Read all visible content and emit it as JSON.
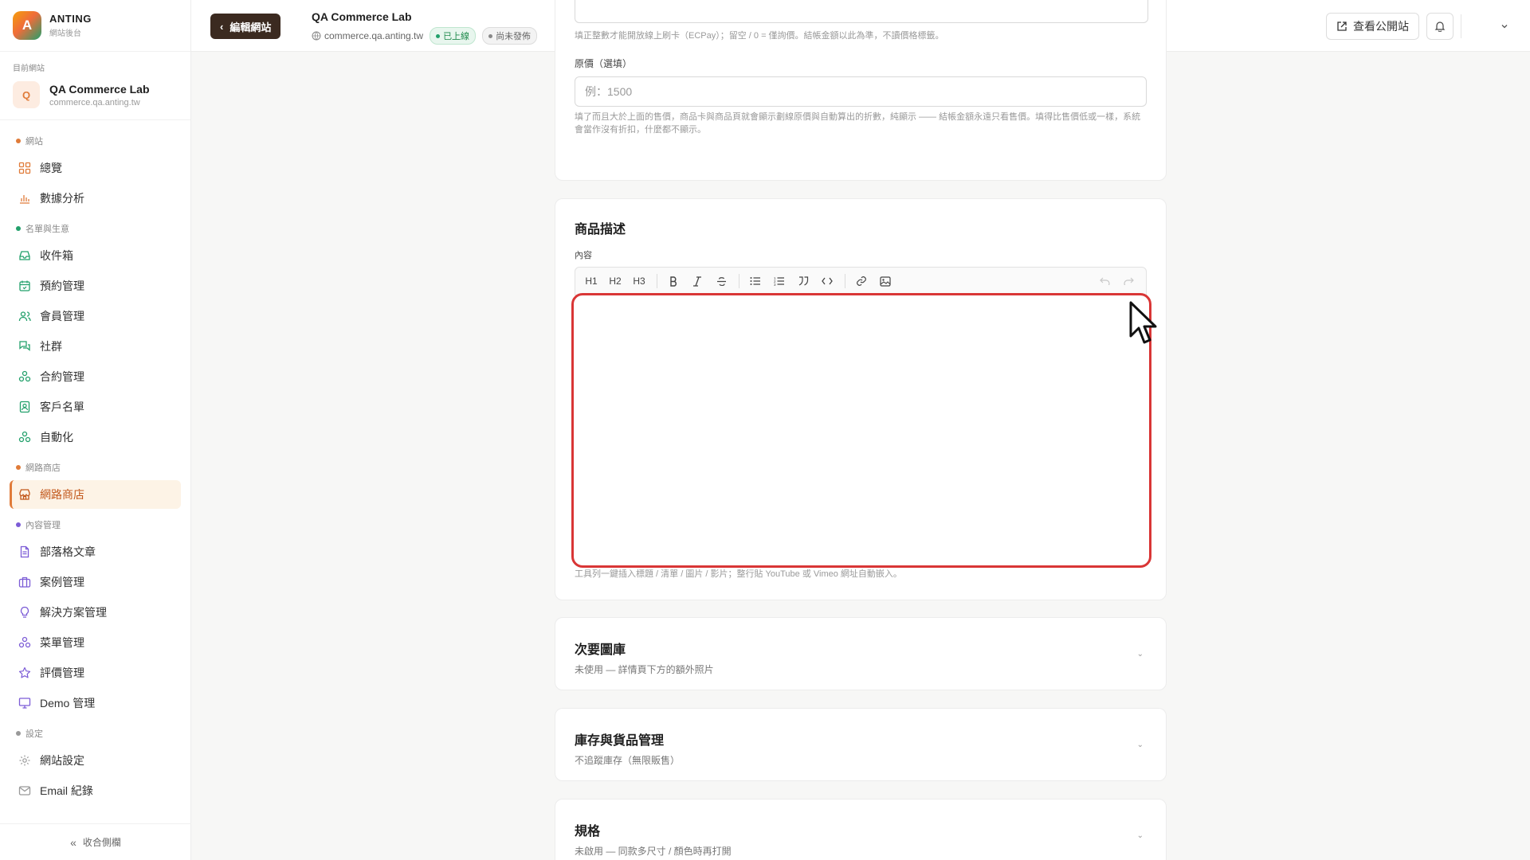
{
  "brand": {
    "name": "ANTING",
    "sub": "網站後台",
    "logo_letter": "A"
  },
  "current_site": {
    "label": "目前網站",
    "avatar": "Q",
    "name": "QA Commerce Lab",
    "domain": "commerce.qa.anting.tw"
  },
  "sidebar": {
    "sections": [
      {
        "title": "網站",
        "color": "#e07b39",
        "items": [
          {
            "label": "總覽",
            "icon": "grid-icon"
          },
          {
            "label": "數據分析",
            "icon": "bar-chart-icon"
          }
        ]
      },
      {
        "title": "名單與生意",
        "color": "#22a06b",
        "items": [
          {
            "label": "收件箱",
            "icon": "inbox-icon"
          },
          {
            "label": "預約管理",
            "icon": "calendar-icon"
          },
          {
            "label": "會員管理",
            "icon": "users-icon"
          },
          {
            "label": "社群",
            "icon": "chat-icon"
          },
          {
            "label": "合約管理",
            "icon": "cluster-icon"
          },
          {
            "label": "客戶名單",
            "icon": "contact-icon"
          },
          {
            "label": "自動化",
            "icon": "automation-icon"
          }
        ]
      },
      {
        "title": "網路商店",
        "color": "#e07b39",
        "items": [
          {
            "label": "網路商店",
            "icon": "store-icon",
            "active": true
          }
        ]
      },
      {
        "title": "內容管理",
        "color": "#7c5cd6",
        "items": [
          {
            "label": "部落格文章",
            "icon": "document-icon"
          },
          {
            "label": "案例管理",
            "icon": "briefcase-icon"
          },
          {
            "label": "解決方案管理",
            "icon": "lightbulb-icon"
          },
          {
            "label": "菜單管理",
            "icon": "menu-cluster-icon"
          },
          {
            "label": "評價管理",
            "icon": "star-icon"
          },
          {
            "label": "Demo 管理",
            "icon": "monitor-icon"
          }
        ]
      },
      {
        "title": "設定",
        "color": "#999999",
        "items": [
          {
            "label": "網站設定",
            "icon": "gear-icon"
          },
          {
            "label": "Email 紀錄",
            "icon": "mail-icon"
          }
        ]
      }
    ],
    "collapse_label": "收合側欄"
  },
  "topbar": {
    "back_label": "編輯網站",
    "title": "QA Commerce Lab",
    "domain": "commerce.qa.anting.tw",
    "badge_live": "已上線",
    "badge_draft": "尚未發佈",
    "view_site": "查看公開站"
  },
  "pricing": {
    "price_hint": "填正整數才能開放線上刷卡（ECPay）；留空 / 0 = 僅詢價。結帳金額以此為準，不讀價格標籤。",
    "original_label": "原價（選填）",
    "original_placeholder": "例：1500",
    "original_hint": "填了而且大於上面的售價，商品卡與商品頁就會顯示劃線原價與自動算出的折數，純顯示 —— 結帳金額永遠只看售價。填得比售價低或一樣，系統會當作沒有折扣，什麼都不顯示。"
  },
  "description": {
    "title": "商品描述",
    "content_label": "內容",
    "toolbar": [
      "H1",
      "H2",
      "H3"
    ],
    "hint": "工具列一鍵插入標題 / 清單 / 圖片 / 影片；整行貼 YouTube 或 Vimeo 網址自動嵌入。"
  },
  "gallery": {
    "title": "次要圖庫",
    "sub": "未使用 — 詳情頁下方的額外照片"
  },
  "inventory": {
    "title": "庫存與貨品管理",
    "sub": "不追蹤庫存（無限販售）"
  },
  "specs": {
    "title": "規格",
    "sub": "未啟用 — 同款多尺寸 / 顏色時再打開"
  }
}
